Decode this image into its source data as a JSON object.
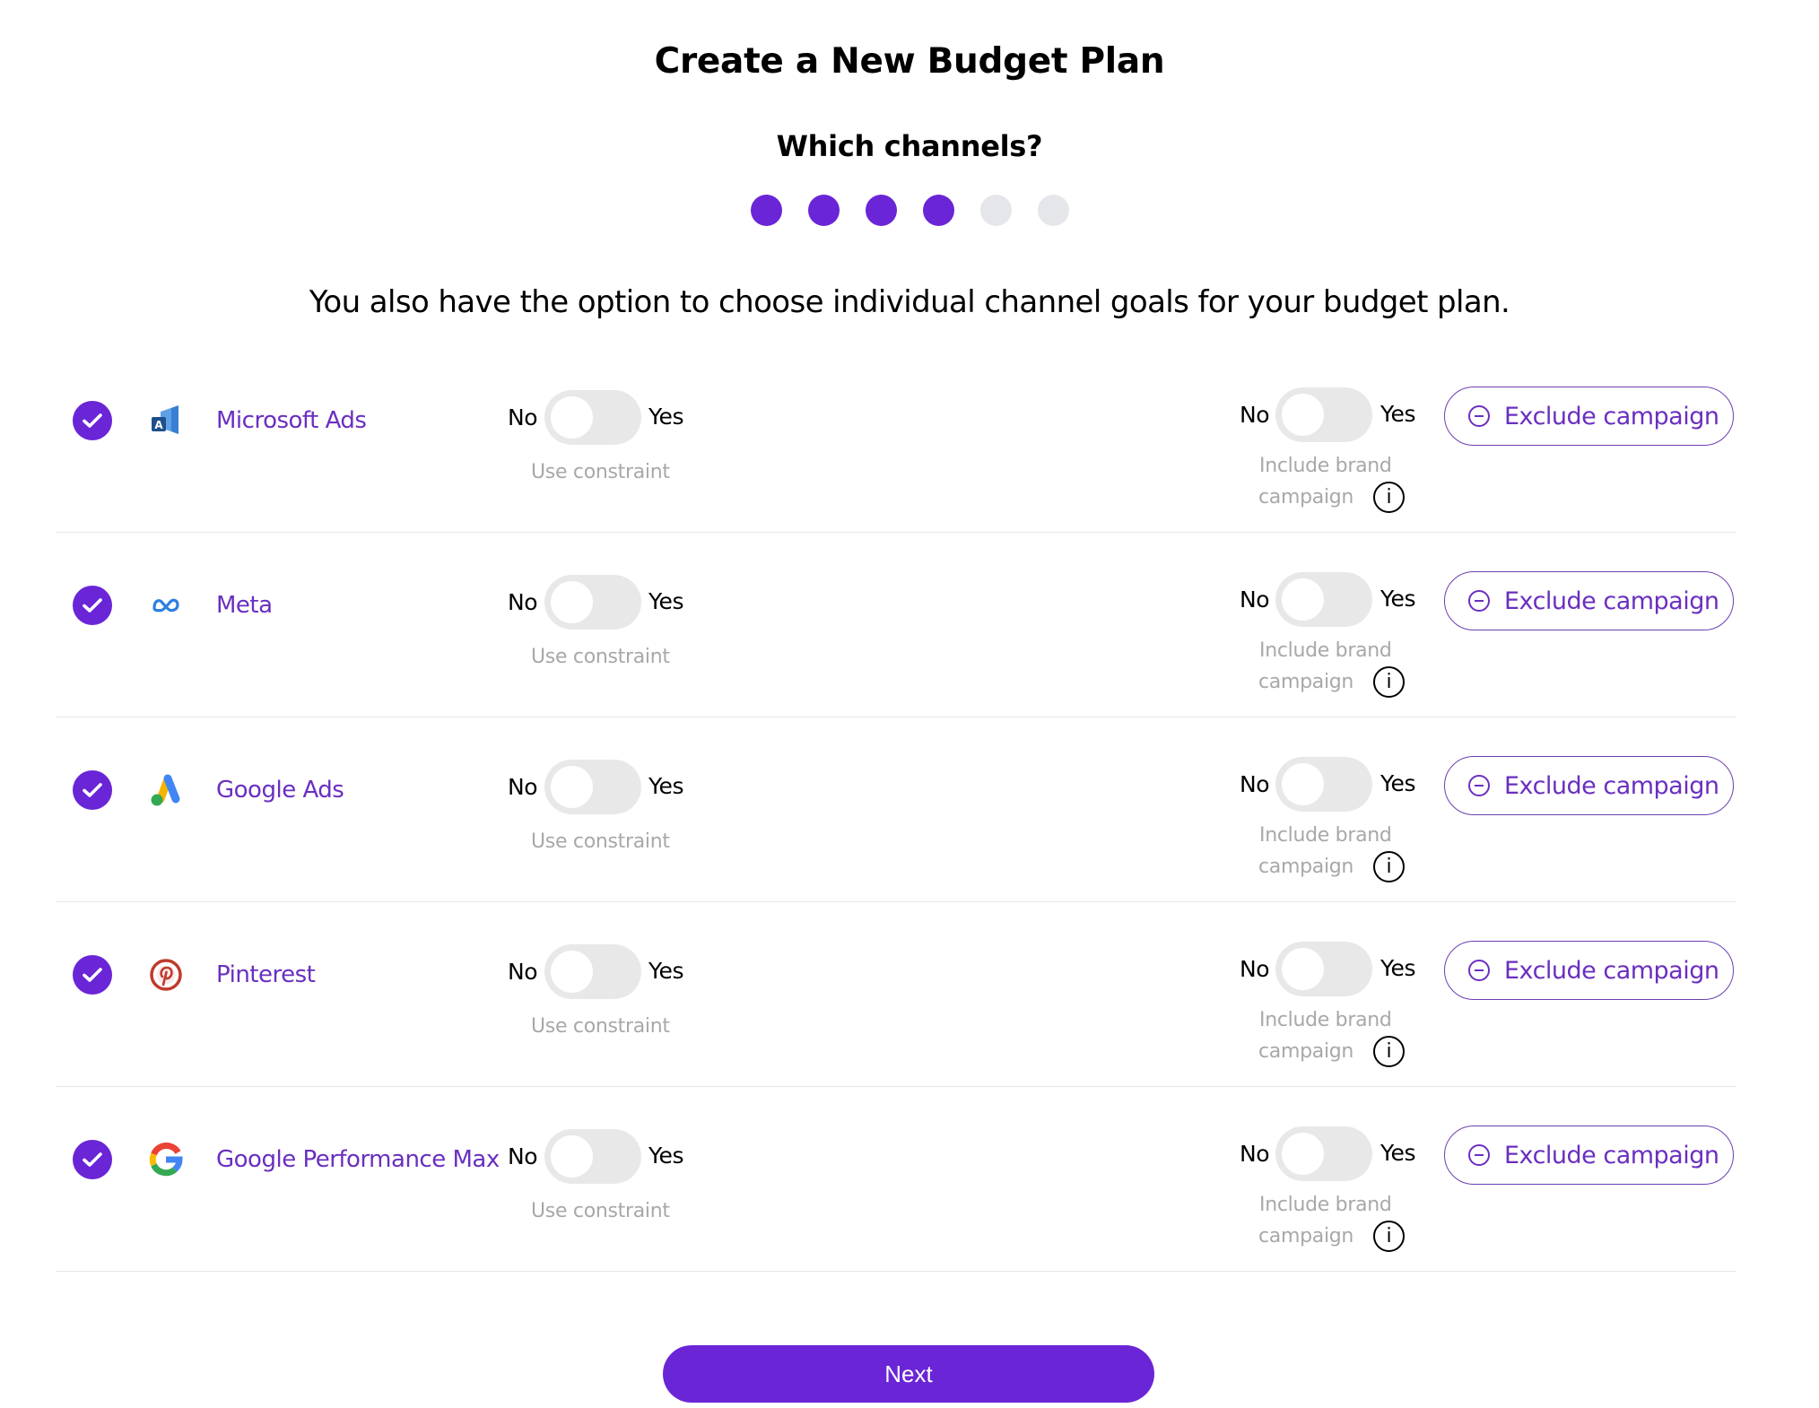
{
  "header": {
    "title": "Create a New Budget Plan",
    "subtitle": "Which channels?",
    "steps": {
      "total": 6,
      "completed": 4
    },
    "intro": "You also have the option to choose individual channel goals for your budget plan."
  },
  "colors": {
    "accent": "#6a25d6",
    "channel_text": "#6a2fc0",
    "step_inactive": "#e5e6ea",
    "toggle_off": "#e8e8e8",
    "hint_text": "#a8a8a8"
  },
  "labels": {
    "no": "No",
    "yes": "Yes",
    "use_constraint": "Use constraint",
    "include_brand_line1": "Include brand",
    "include_brand_line2": "campaign",
    "info_glyph": "i",
    "exclude_campaign": "Exclude campaign"
  },
  "channels": [
    {
      "name": "Microsoft Ads",
      "icon": "microsoft-ads-icon",
      "selected": true,
      "use_constraint": false,
      "include_brand_campaign": false
    },
    {
      "name": "Meta",
      "icon": "meta-icon",
      "selected": true,
      "use_constraint": false,
      "include_brand_campaign": false
    },
    {
      "name": "Google Ads",
      "icon": "google-ads-icon",
      "selected": true,
      "use_constraint": false,
      "include_brand_campaign": false
    },
    {
      "name": "Pinterest",
      "icon": "pinterest-icon",
      "selected": true,
      "use_constraint": false,
      "include_brand_campaign": false
    },
    {
      "name": "Google Performance Max",
      "icon": "google-icon",
      "selected": true,
      "use_constraint": false,
      "include_brand_campaign": false
    }
  ],
  "footer": {
    "next_label": "Next"
  }
}
